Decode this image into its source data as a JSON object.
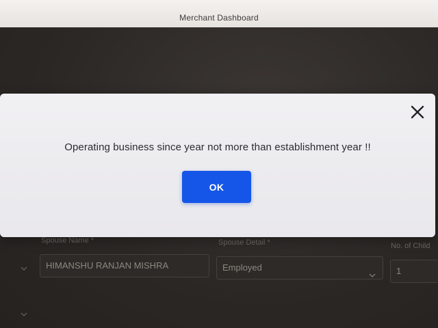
{
  "window": {
    "title": "Merchant Dashboard"
  },
  "modal": {
    "message": "Operating business since year not more than establishment year !!",
    "ok_label": "OK",
    "close_icon": "close-icon"
  },
  "form": {
    "spouse_name_label": "Spouse Name *",
    "spouse_name_value": "HIMANSHU RANJAN MISHRA",
    "spouse_detail_label": "Spouse Detail *",
    "spouse_detail_value": "Employed",
    "children_label": "No. of Child",
    "children_value": "1"
  },
  "colors": {
    "accent": "#1556e8",
    "modal_bg": "#eeedf0",
    "backdrop": "#2e2a28"
  }
}
